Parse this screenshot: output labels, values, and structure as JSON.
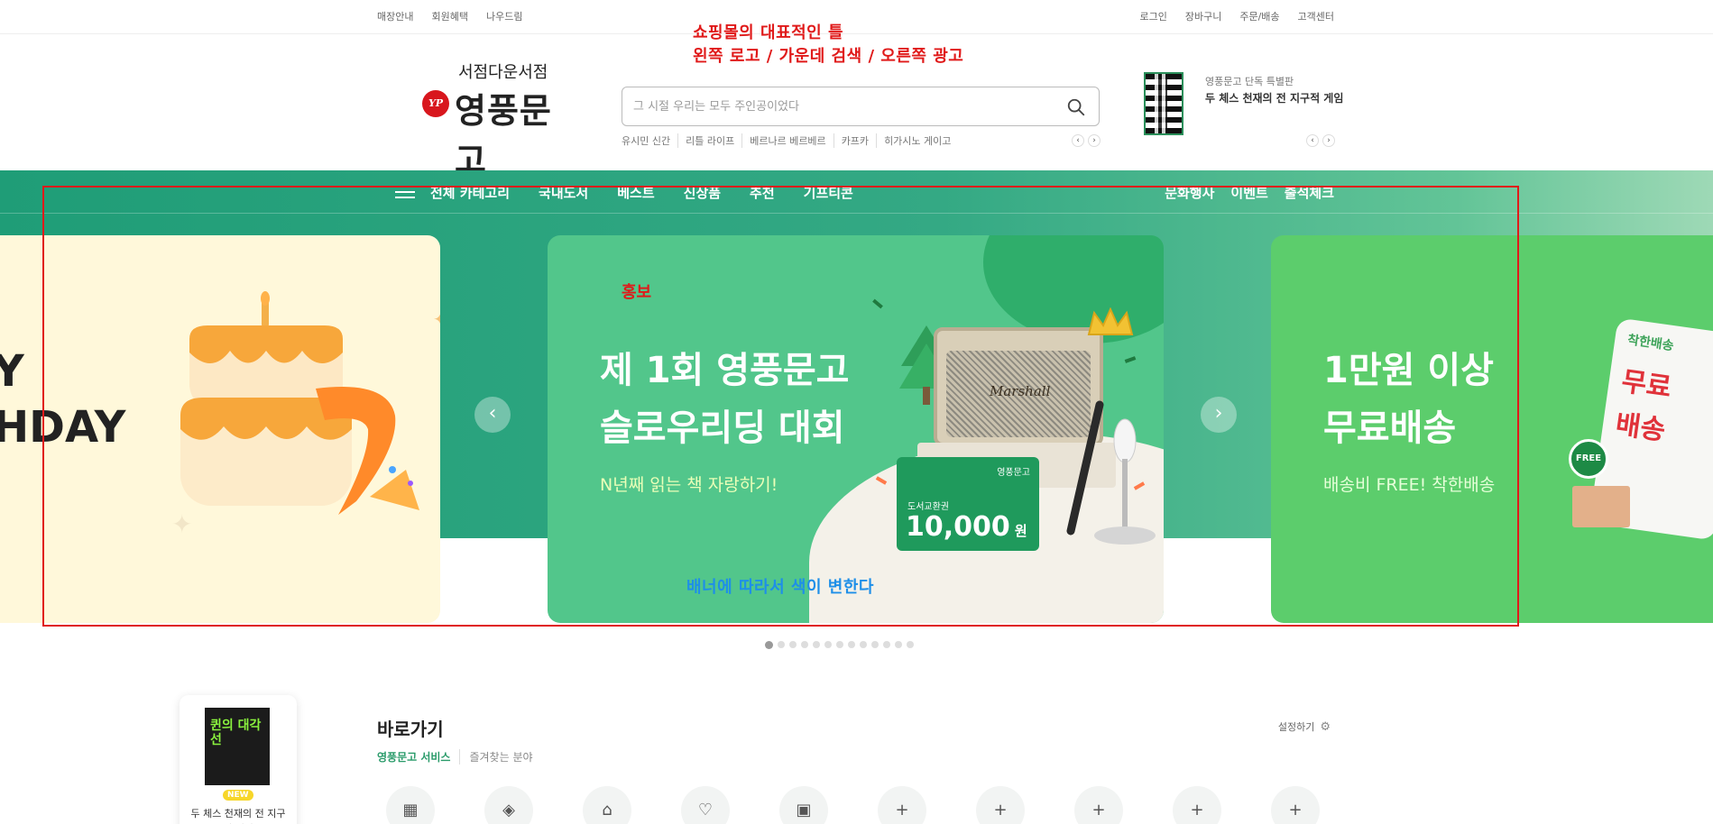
{
  "util": {
    "left": [
      "매장안내",
      "회원혜택",
      "나우드림"
    ],
    "right": [
      "로그인",
      "장바구니",
      "주문/배송",
      "고객센터"
    ]
  },
  "annotations": {
    "top_line1": "쇼핑몰의 대표적인 틀",
    "top_line2": "왼쪽 로고 / 가운데 검색 / 오른쪽 광고",
    "promo": "홍보",
    "color_note": "배너에 따라서 색이 변한다",
    "box_color": "#e01a1a",
    "note_color": "#1e8fe8"
  },
  "logo": {
    "sub": "서점다운서점",
    "mark": "YP",
    "name": "영풍문고"
  },
  "search": {
    "placeholder": "그 시절 우리는 모두 주인공이었다",
    "icon": "search-icon",
    "keywords": [
      "유시민 신간",
      "리틀 라이프",
      "베르나르 베르베르",
      "카프카",
      "히가시노 게이고"
    ]
  },
  "ad": {
    "label": "영풍문고 단독 특별판",
    "title": "두 체스 천재의 전 지구적 게임"
  },
  "gnb": {
    "menu_icon": "hamburger-icon",
    "left": [
      "전체 카테고리",
      "국내도서",
      "베스트",
      "신상품",
      "추천",
      "기프티콘"
    ],
    "right": [
      "문화행사",
      "이벤트",
      "출석체크"
    ],
    "accent": "#1f9d77"
  },
  "banners": {
    "left": {
      "line1": "Y",
      "line2": "HDAY"
    },
    "center": {
      "title1": "제 1회 영풍문고",
      "title2": "슬로우리딩 대회",
      "sub": "N년째 읽는 책 자랑하기!",
      "voucher_brand": "영풍문고",
      "voucher_label": "도서교환권",
      "voucher_amount": "10,000",
      "voucher_unit": "원",
      "speaker_brand": "Marshall"
    },
    "right": {
      "title1": "1만원 이상",
      "title2": "무료배송",
      "sub": "배송비 FREE! 착한배송",
      "sign_small": "착한배송",
      "sign_big1": "무료",
      "sign_big2": "배송",
      "badge": "FREE"
    },
    "prev_icon": "chevron-left-icon",
    "next_icon": "chevron-right-icon",
    "page_count": 13,
    "active_page": 1
  },
  "shortcut": {
    "title": "바로가기",
    "tabs": [
      "영풍문고 서비스",
      "즐겨찾는 분야"
    ],
    "setting": "설정하기",
    "setting_icon": "gear-icon",
    "items": [
      "calendar-check-icon",
      "coupon-icon",
      "store-icon",
      "gift-hand-icon",
      "gift-box-icon",
      "plus-icon",
      "plus-icon",
      "plus-icon",
      "plus-icon",
      "plus-icon"
    ]
  },
  "side_card": {
    "cover_text": "퀸의 대각선",
    "badge": "NEW",
    "desc": "두 체스 천재의 전 지구적 게임"
  }
}
